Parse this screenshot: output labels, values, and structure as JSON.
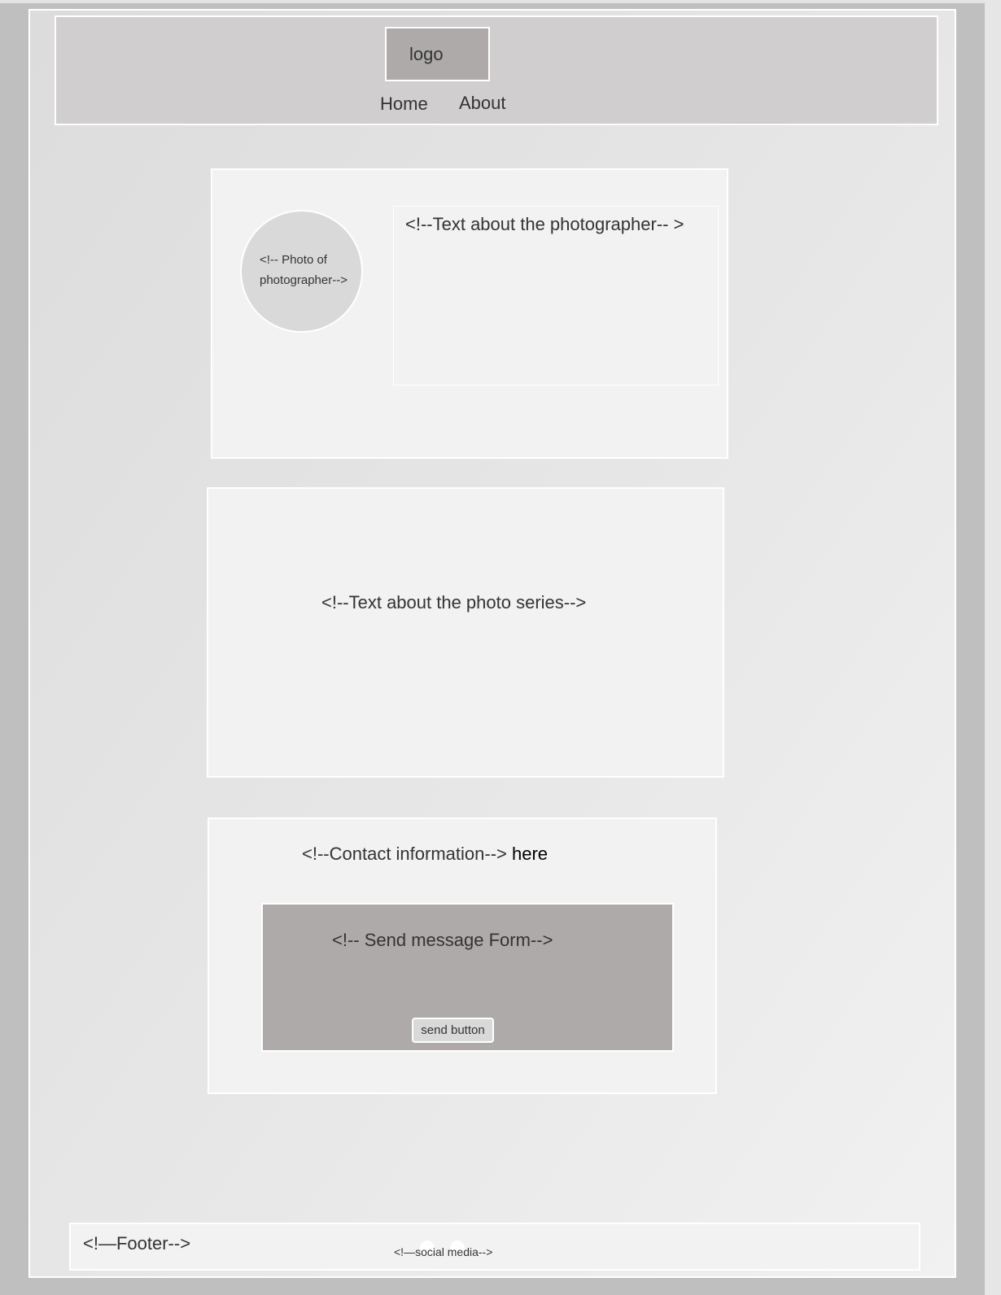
{
  "header": {
    "logo": "logo",
    "nav": [
      {
        "label": "Home"
      },
      {
        "label": "About"
      }
    ]
  },
  "about_photographer": {
    "photo_placeholder_line1": "<!-- Photo of",
    "photo_placeholder_line2": "photographer-->",
    "text_placeholder": "<!--Text about the photographer-- >"
  },
  "photo_series": {
    "text_placeholder": "<!--Text about the photo series-->"
  },
  "contact": {
    "info_placeholder": "<!--Contact information-->",
    "info_suffix": "here",
    "form_placeholder": "<!-- Send message Form-->",
    "send_button": "send button"
  },
  "footer": {
    "label": "<!—Footer-->",
    "social_media": "<!—social media-->"
  }
}
